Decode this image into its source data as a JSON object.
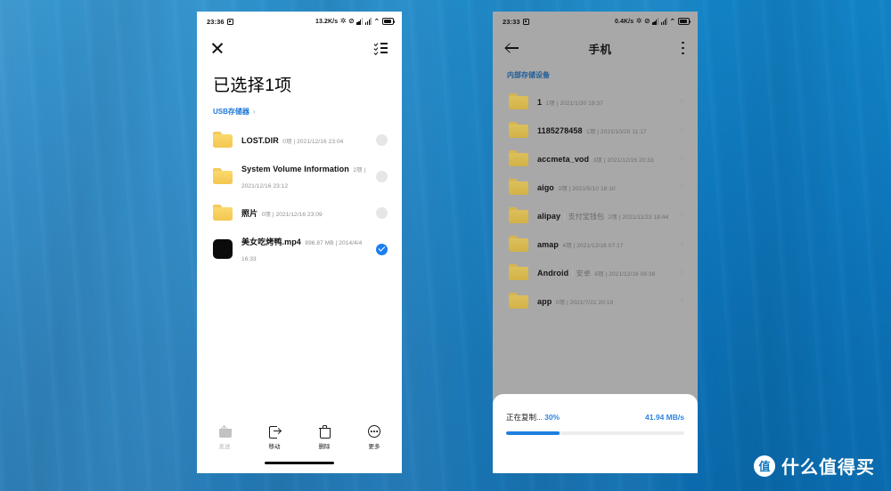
{
  "background": {
    "accent": "#0e78bd"
  },
  "left_phone": {
    "statusbar": {
      "time": "23:36",
      "speed": "13.2K/s",
      "alarm_icon": "alarm-icon",
      "bluetooth_icon": "bluetooth-icon",
      "mute_icon": "mute-icon",
      "wifi_icon": "wifi-icon",
      "battery_icon": "battery-icon"
    },
    "appbar": {
      "close_icon": "close-icon",
      "select_all_icon": "select-all-icon"
    },
    "title": "已选择1项",
    "breadcrumb": {
      "label": "USB存储器",
      "chevron": "›"
    },
    "files": [
      {
        "name": "LOST.DIR",
        "alias": "",
        "sub": "0项 | 2021/12/16 23:04",
        "type": "folder",
        "selected": false
      },
      {
        "name": "System Volume Information",
        "alias": "",
        "sub": "2项 | 2021/12/16 23:12",
        "type": "folder",
        "selected": false
      },
      {
        "name": "照片",
        "alias": "",
        "sub": "0项 | 2021/12/16 23:09",
        "type": "folder",
        "selected": false
      },
      {
        "name": "美女吃烤鸭.mp4",
        "alias": "",
        "sub": "896.87 MB | 2014/4/4 16:33",
        "type": "video",
        "selected": true
      }
    ],
    "toolbar": [
      {
        "label": "发送",
        "icon": "share-icon",
        "disabled": true
      },
      {
        "label": "移动",
        "icon": "move-icon",
        "disabled": false
      },
      {
        "label": "删除",
        "icon": "trash-icon",
        "disabled": false
      },
      {
        "label": "更多",
        "icon": "more-icon",
        "disabled": false
      }
    ]
  },
  "right_phone": {
    "statusbar": {
      "time": "23:33",
      "speed": "0.4K/s",
      "alarm_icon": "alarm-icon",
      "bluetooth_icon": "bluetooth-icon",
      "mute_icon": "mute-icon",
      "wifi_icon": "wifi-icon",
      "battery_icon": "battery-icon"
    },
    "appbar": {
      "back_icon": "back-icon",
      "title": "手机",
      "menu_icon": "kebab-menu-icon"
    },
    "breadcrumb": {
      "label": "内部存储设备",
      "chevron": "›"
    },
    "files": [
      {
        "name": "1",
        "alias": "",
        "sub": "1项 | 2021/1/30 19:37"
      },
      {
        "name": "1185278458",
        "alias": "",
        "sub": "1项 | 2021/10/20 11:17"
      },
      {
        "name": "accmeta_vod",
        "alias": "",
        "sub": "3项 | 2021/12/16 20:33"
      },
      {
        "name": "aigo",
        "alias": "",
        "sub": "3项 | 2021/5/10 18:10"
      },
      {
        "name": "alipay",
        "alias": "支付宝钱包",
        "sub": "2项 | 2021/11/23 18:44"
      },
      {
        "name": "amap",
        "alias": "",
        "sub": "4项 | 2021/12/16 07:17"
      },
      {
        "name": "Android",
        "alias": "安卓",
        "sub": "8项 | 2021/12/16 06:38"
      },
      {
        "name": "app",
        "alias": "",
        "sub": "0项 | 2021/7/22 20:19"
      }
    ],
    "copy_dialog": {
      "status_label": "正在复制...",
      "percent_label": "30%",
      "percent_value": 30,
      "speed_label": "41.94 MB/s",
      "bar_color": "#1f7fe0"
    }
  },
  "watermark": {
    "logo_char": "值",
    "text": "什么值得买"
  }
}
